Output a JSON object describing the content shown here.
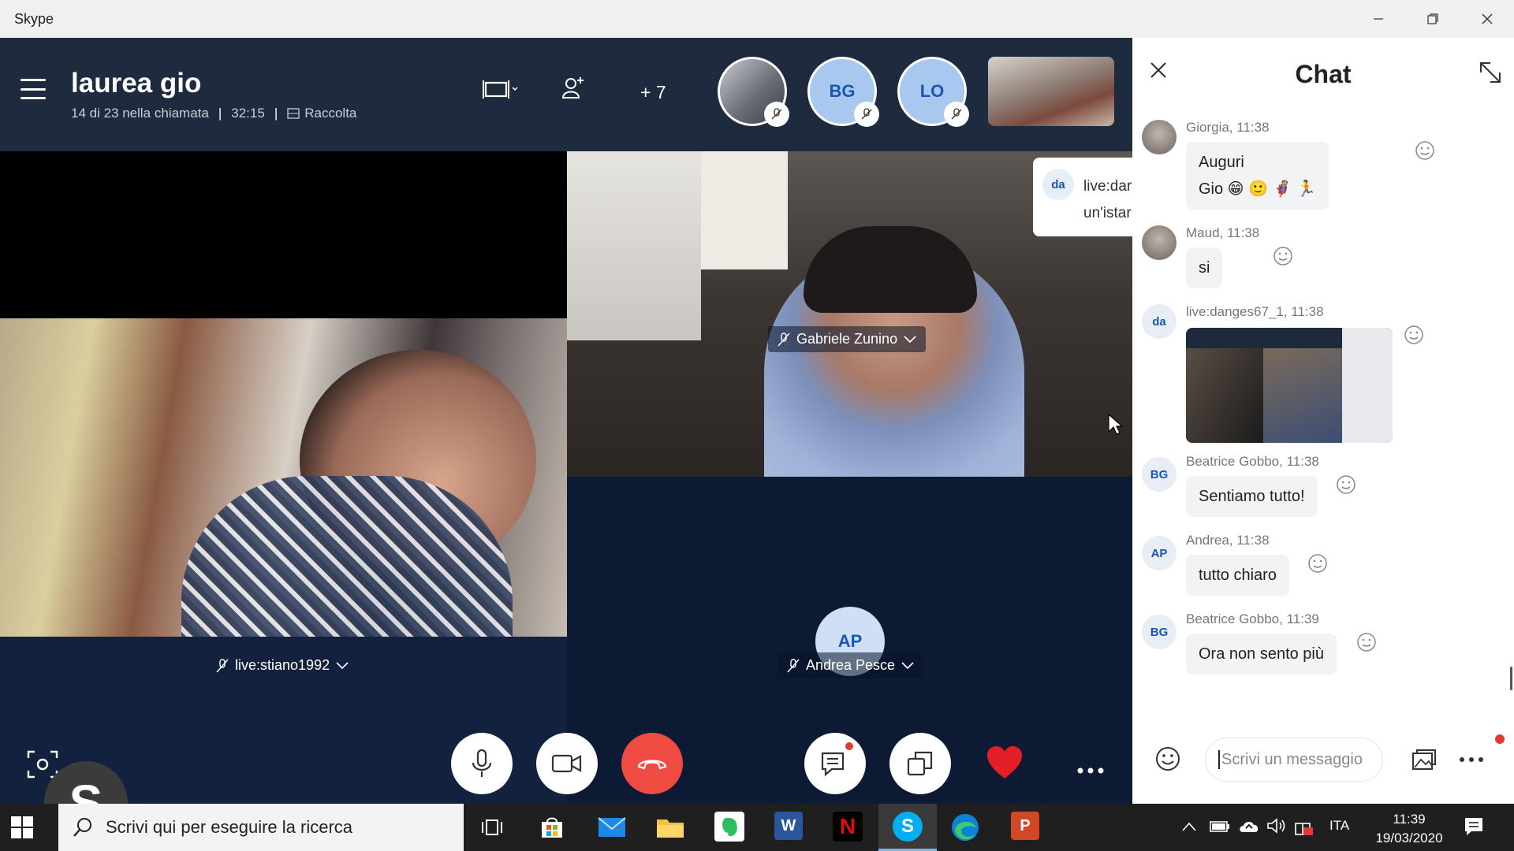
{
  "window": {
    "title": "Skype"
  },
  "call": {
    "title": "laurea gio",
    "participants_info": "14 di 23 nella chiamata",
    "duration": "32:15",
    "gallery_label": "Raccolta",
    "more_count": "+ 7",
    "header_avatars": [
      {
        "initials": "BG"
      },
      {
        "initials": "LO"
      }
    ]
  },
  "videos": {
    "left_name": "live:stiano1992",
    "center_name": "Gabriele Zunino",
    "audio_name": "Andrea Pesce",
    "audio_initials": "AP"
  },
  "toast": {
    "avatar": "da",
    "line1": "live:dar",
    "line2": "un'istar"
  },
  "chat": {
    "title": "Chat",
    "messages": [
      {
        "sender": "Giorgia, 11:38",
        "avatar": "",
        "text1": "Auguri",
        "text2": "Gio 😁 🙂 🦸 🏃"
      },
      {
        "sender": "Maud, 11:38",
        "avatar": "",
        "text1": "si"
      },
      {
        "sender": "live:danges67_1, 11:38",
        "avatar": "da"
      },
      {
        "sender": "Beatrice Gobbo, 11:38",
        "avatar": "BG",
        "text1": "Sentiamo tutto!"
      },
      {
        "sender": "Andrea, 11:38",
        "avatar": "AP",
        "text1": "tutto chiaro"
      },
      {
        "sender": "Beatrice Gobbo, 11:39",
        "avatar": "BG",
        "text1": "Ora non sento più"
      }
    ],
    "composer_placeholder": "Scrivi un messaggio"
  },
  "taskbar": {
    "search_placeholder": "Scrivi qui per eseguire la ricerca",
    "language": "ITA",
    "time": "11:39",
    "date": "19/03/2020",
    "apps": [
      "task-view",
      "store",
      "mail",
      "file-explorer",
      "evernote",
      "word",
      "netflix",
      "skype",
      "edge",
      "powerpoint"
    ]
  },
  "colors": {
    "header_bg": "#1e2b3e",
    "end_call": "#ef4b43",
    "accent": "#1a56b0"
  }
}
